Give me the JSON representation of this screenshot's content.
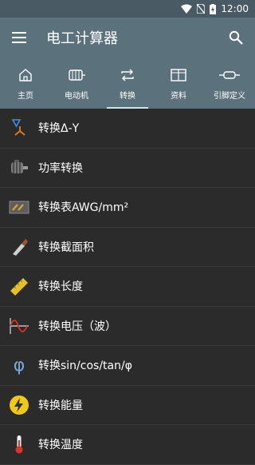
{
  "status": {
    "time": "12:00"
  },
  "app": {
    "title": "电工计算器"
  },
  "tabs": [
    {
      "label": "主页",
      "icon": "home-icon"
    },
    {
      "label": "电动机",
      "icon": "motor-icon"
    },
    {
      "label": "转换",
      "icon": "convert-icon",
      "active": true
    },
    {
      "label": "资料",
      "icon": "book-icon"
    },
    {
      "label": "引脚定义",
      "icon": "connector-icon"
    }
  ],
  "items": [
    {
      "label": "转换Δ-Y",
      "icon": "delta-star-icon"
    },
    {
      "label": "功率转换",
      "icon": "motor-photo-icon"
    },
    {
      "label": "转换表AWG/mm²",
      "icon": "wire-gauge-icon"
    },
    {
      "label": "转换截面积",
      "icon": "cable-icon"
    },
    {
      "label": "转换长度",
      "icon": "ruler-icon"
    },
    {
      "label": "转换电压（波）",
      "icon": "sine-wave-icon"
    },
    {
      "label": "转换sin/cos/tan/φ",
      "icon": "phi-icon"
    },
    {
      "label": "转换能量",
      "icon": "lightning-icon"
    },
    {
      "label": "转换温度",
      "icon": "thermometer-icon"
    }
  ],
  "colors": {
    "appbar": "#5b717c",
    "statusbar": "#4a5a64",
    "background": "#2b2b2b"
  }
}
